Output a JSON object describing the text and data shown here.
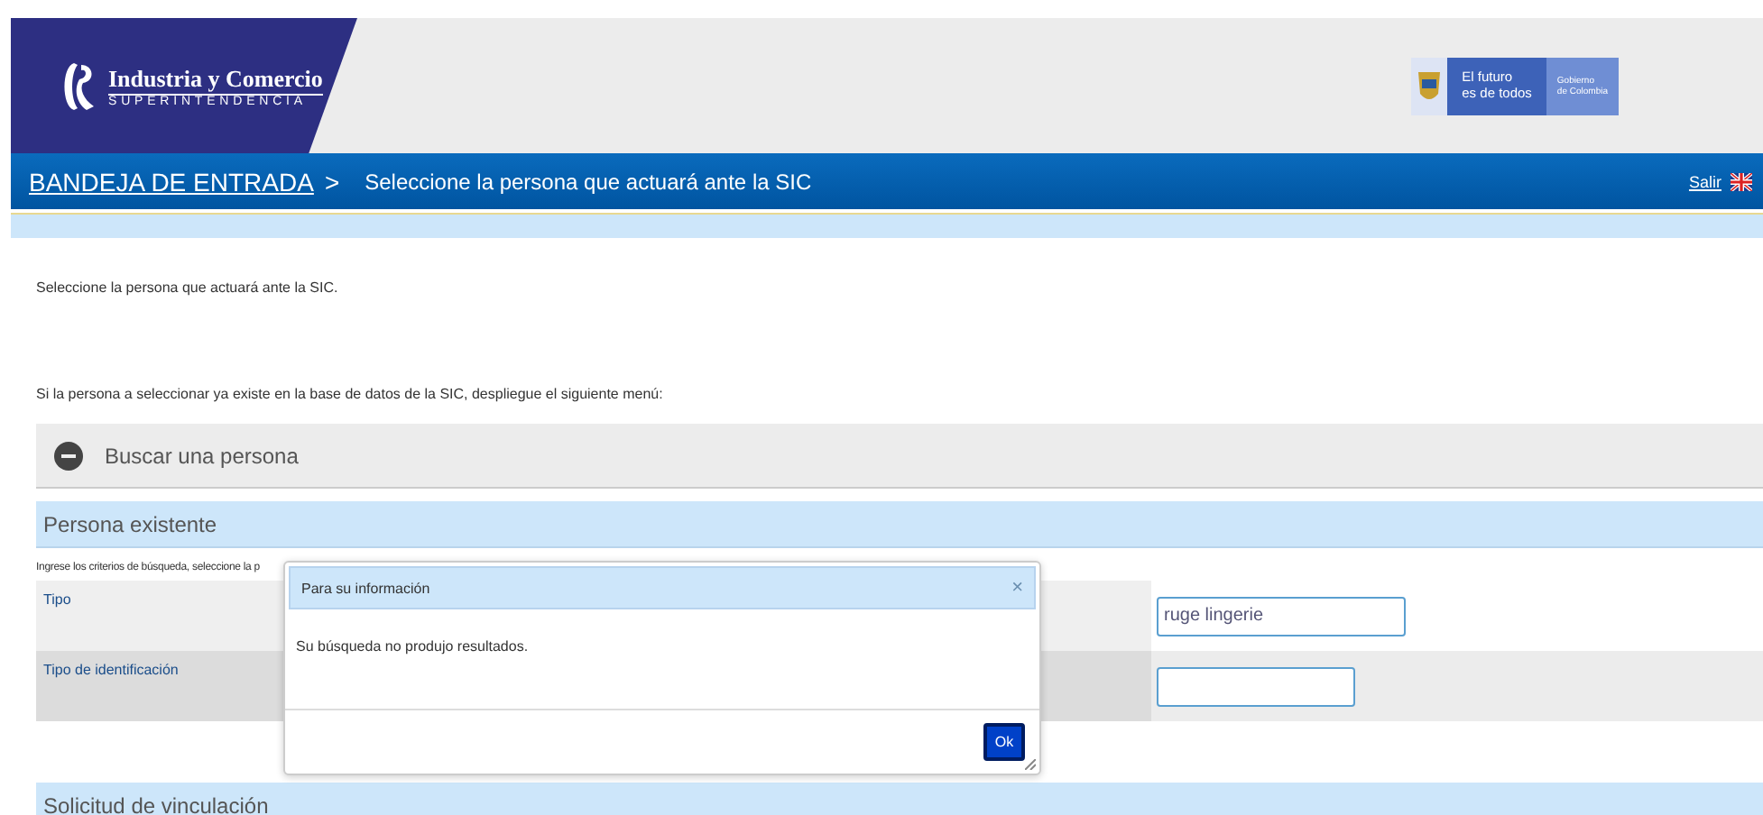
{
  "header": {
    "logo_title": "Industria y Comercio",
    "logo_subtitle": "SUPERINTENDENCIA",
    "gov_logo_line1": "El futuro",
    "gov_logo_line2": "es de todos",
    "gov_logo_side1": "Gobierno",
    "gov_logo_side2": "de Colombia"
  },
  "nav": {
    "home_link": "BANDEJA DE ENTRADA",
    "separator": ">",
    "page_title": "Seleccione la persona que actuará ante la SIC",
    "exit_link": "Salir"
  },
  "intro": "Seleccione la persona que actuará ante la SIC.",
  "hint": "Si la persona a seleccionar ya existe en la base de datos de la SIC, despliegue el siguiente menú:",
  "accordion": {
    "label": "Buscar una persona",
    "expanded": true
  },
  "section_existing": "Persona existente",
  "instructions": "Ingrese los criterios de búsqueda, seleccione la p",
  "form_rows": [
    {
      "label": "Tipo",
      "value": "ruge lingerie",
      "wide": true
    },
    {
      "label": "Tipo de identificación",
      "value": "",
      "wide": false
    }
  ],
  "section_link": "Solicitud de vinculación",
  "dialog": {
    "title": "Para su información",
    "close": "×",
    "message": "Su búsqueda no produjo resultados.",
    "button": "Ok"
  }
}
